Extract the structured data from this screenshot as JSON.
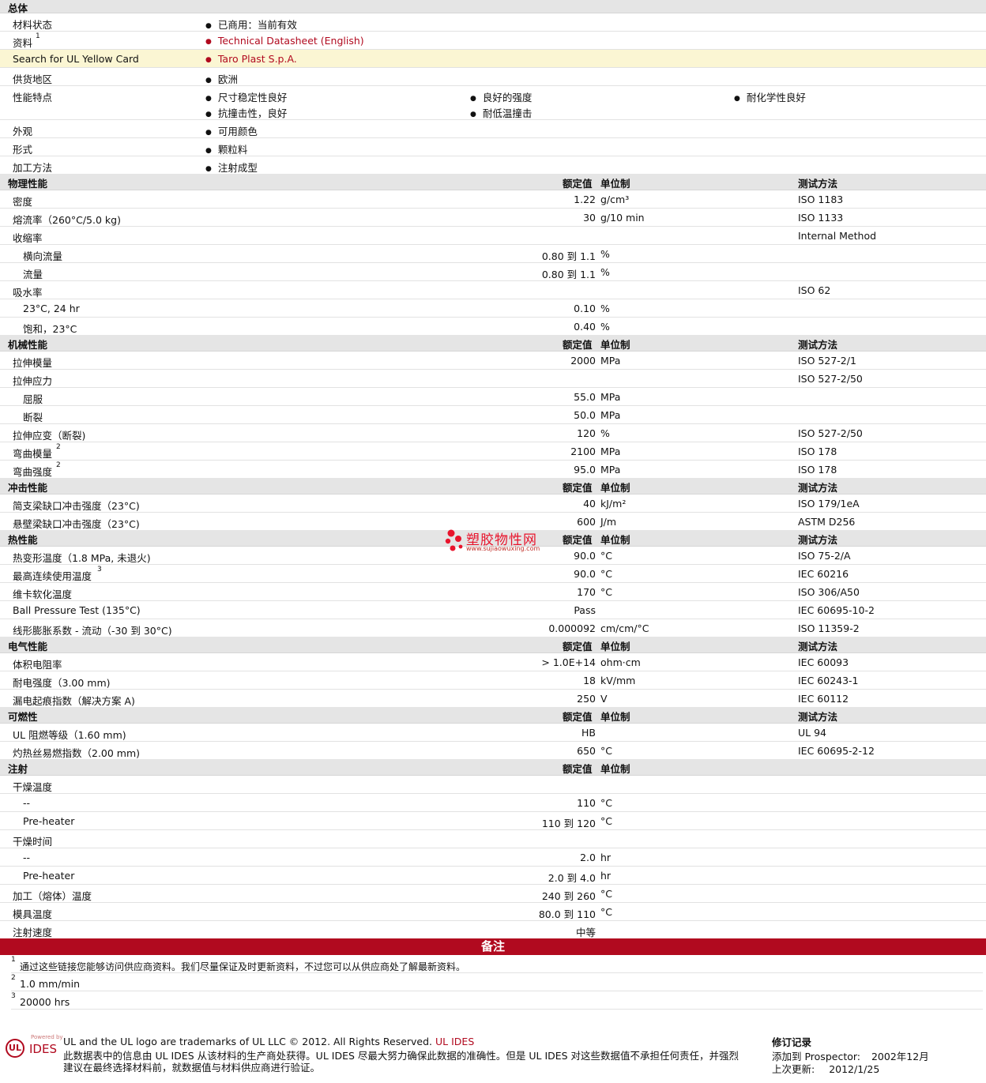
{
  "general": {
    "title": "总体",
    "rows": [
      {
        "label": "材料状态",
        "values": [
          "已商用：当前有效"
        ]
      },
      {
        "label": "资料",
        "sup": "1",
        "values": [
          "Technical Datasheet (English)"
        ],
        "link": true
      },
      {
        "label": "Search for UL Yellow Card",
        "values": [
          "Taro Plast S.p.A."
        ],
        "link": true
      },
      {
        "label": "供货地区",
        "values": [
          "欧洲"
        ]
      },
      {
        "label": "性能特点",
        "values": [
          "尺寸稳定性良好",
          "良好的强度",
          "耐化学性良好",
          "抗撞击性，良好",
          "耐低温撞击"
        ]
      },
      {
        "label": "外观",
        "values": [
          "可用颜色"
        ]
      },
      {
        "label": "形式",
        "values": [
          "颗粒料"
        ]
      },
      {
        "label": "加工方法",
        "values": [
          "注射成型"
        ]
      }
    ]
  },
  "headers": {
    "value": "额定值",
    "unit": "单位制",
    "method": "测试方法"
  },
  "sections": [
    {
      "title": "物理性能",
      "rows": [
        {
          "label": "密度",
          "value": "1.22",
          "unit": "g/cm³",
          "method": "ISO 1183"
        },
        {
          "label": "熔流率（260°C/5.0 kg)",
          "value": "30",
          "unit": "g/10 min",
          "method": "ISO 1133"
        },
        {
          "label": "收缩率",
          "value": "",
          "unit": "",
          "method": "Internal Method"
        },
        {
          "label": "横向流量",
          "indent": true,
          "value": "0.80 到  1.1",
          "unit": "%",
          "method": ""
        },
        {
          "label": "流量",
          "indent": true,
          "value": "0.80 到  1.1",
          "unit": "%",
          "method": ""
        },
        {
          "label": "吸水率",
          "value": "",
          "unit": "",
          "method": "ISO 62"
        },
        {
          "label": "23°C, 24 hr",
          "indent": true,
          "value": "0.10",
          "unit": "%",
          "method": ""
        },
        {
          "label": "饱和，23°C",
          "indent": true,
          "value": "0.40",
          "unit": "%",
          "method": ""
        }
      ]
    },
    {
      "title": "机械性能",
      "rows": [
        {
          "label": "拉伸模量",
          "value": "2000",
          "unit": "MPa",
          "method": "ISO 527-2/1"
        },
        {
          "label": "拉伸应力",
          "value": "",
          "unit": "",
          "method": "ISO 527-2/50"
        },
        {
          "label": "屈服",
          "indent": true,
          "value": "55.0",
          "unit": "MPa",
          "method": ""
        },
        {
          "label": "断裂",
          "indent": true,
          "value": "50.0",
          "unit": "MPa",
          "method": ""
        },
        {
          "label": "拉伸应变（断裂)",
          "value": "120",
          "unit": "%",
          "method": "ISO 527-2/50"
        },
        {
          "label": "弯曲模量",
          "sup": "2",
          "value": "2100",
          "unit": "MPa",
          "method": "ISO 178"
        },
        {
          "label": "弯曲强度",
          "sup": "2",
          "value": "95.0",
          "unit": "MPa",
          "method": "ISO 178"
        }
      ]
    },
    {
      "title": "冲击性能",
      "rows": [
        {
          "label": "简支梁缺口冲击强度（23°C)",
          "value": "40",
          "unit": "kJ/m²",
          "method": "ISO 179/1eA"
        },
        {
          "label": "悬壁梁缺口冲击强度（23°C)",
          "value": "600",
          "unit": "J/m",
          "method": "ASTM D256"
        }
      ]
    },
    {
      "title": "热性能",
      "rows": [
        {
          "label": "热变形温度（1.8 MPa, 未退火)",
          "value": "90.0",
          "unit": "°C",
          "method": "ISO 75-2/A"
        },
        {
          "label": "最高连续使用温度",
          "sup": "3",
          "value": "90.0",
          "unit": "°C",
          "method": "IEC 60216"
        },
        {
          "label": "维卡软化温度",
          "value": "170",
          "unit": "°C",
          "method": "ISO 306/A50"
        },
        {
          "label": "Ball Pressure Test (135°C)",
          "value": "Pass",
          "unit": "",
          "method": "IEC 60695-10-2"
        },
        {
          "label": "线形膨胀系数 - 流动（-30 到  30°C)",
          "value": "0.000092",
          "unit": "cm/cm/°C",
          "method": "ISO 11359-2"
        }
      ]
    },
    {
      "title": "电气性能",
      "rows": [
        {
          "label": "体积电阻率",
          "value": "> 1.0E+14",
          "unit": "ohm·cm",
          "method": "IEC 60093"
        },
        {
          "label": "耐电强度（3.00 mm)",
          "value": "18",
          "unit": "kV/mm",
          "method": "IEC 60243-1"
        },
        {
          "label": "漏电起痕指数（解决方案  A)",
          "value": "250",
          "unit": "V",
          "method": "IEC 60112"
        }
      ]
    },
    {
      "title": "可燃性",
      "rows": [
        {
          "label": "UL 阻燃等级（1.60 mm)",
          "value": "HB",
          "unit": "",
          "method": "UL 94"
        },
        {
          "label": "灼热丝易燃指数（2.00 mm)",
          "value": "650",
          "unit": "°C",
          "method": "IEC 60695-2-12"
        }
      ]
    },
    {
      "title": "注射",
      "noMethod": true,
      "rows": [
        {
          "label": "干燥温度",
          "value": "",
          "unit": "",
          "method": ""
        },
        {
          "label": "--",
          "indent": true,
          "value": "110",
          "unit": "°C",
          "method": ""
        },
        {
          "label": "Pre-heater",
          "indent": true,
          "value": "110 到  120",
          "unit": "°C",
          "method": ""
        },
        {
          "label": "干燥时间",
          "value": "",
          "unit": "",
          "method": ""
        },
        {
          "label": "--",
          "indent": true,
          "value": "2.0",
          "unit": "hr",
          "method": ""
        },
        {
          "label": "Pre-heater",
          "indent": true,
          "value": "2.0 到  4.0",
          "unit": "hr",
          "method": ""
        },
        {
          "label": "加工（熔体）温度",
          "value": "240 到  260",
          "unit": "°C",
          "method": ""
        },
        {
          "label": "模具温度",
          "value": "80.0 到  110",
          "unit": "°C",
          "method": ""
        },
        {
          "label": "注射速度",
          "value": "中等",
          "unit": "",
          "method": ""
        }
      ]
    }
  ],
  "notes": {
    "title": "备注",
    "items": [
      {
        "sup": "1",
        "text": "通过这些链接您能够访问供应商资料。我们尽量保证及时更新资料，不过您可以从供应商处了解最新资料。"
      },
      {
        "sup": "2",
        "text": "1.0 mm/min"
      },
      {
        "sup": "3",
        "text": "20000 hrs"
      }
    ]
  },
  "watermark": {
    "text": "塑胶物性网",
    "url": "www.sujiaowuxing.com"
  },
  "footer": {
    "logo_small": "Powered by",
    "logo_ul": "UL",
    "logo_ides": "IDES",
    "trademark": "UL and the UL logo are trademarks of UL LLC © 2012. All Rights Reserved.",
    "trademark_link": "UL IDES",
    "disclaimer1": "此数据表中的信息由  UL IDES 从该材料的生产商处获得。UL IDES 尽最大努力确保此数据的准确性。但是  UL IDES 对这些数据值不承担任何责任，并强烈",
    "disclaimer2": "建议在最终选择材料前，就数据值与材料供应商进行验证。",
    "revision_title": "修订记录",
    "added_label": "添加到  Prospector:",
    "added_value": "2002年12月",
    "updated_label": "上次更新:",
    "updated_value": "2012/1/25"
  },
  "colors": {
    "accent": "#b10a1f",
    "section_bg": "#e5e5e5",
    "highlight_row": "#fbf6d3"
  }
}
